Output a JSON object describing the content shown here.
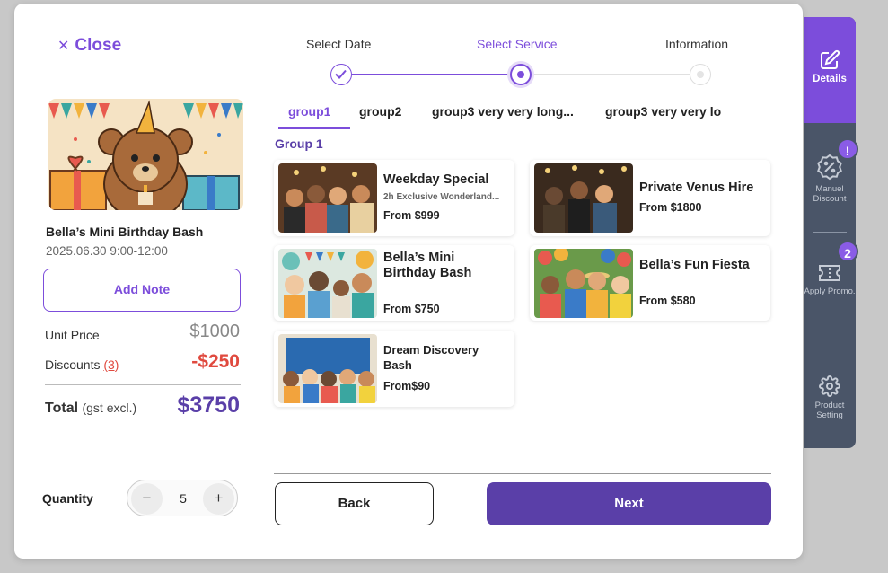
{
  "close": {
    "label": "Close"
  },
  "item": {
    "title": "Bella’s Mini Birthday Bash",
    "date": "2025.06.30 9:00-12:00"
  },
  "add_note": "Add Note",
  "pricing": {
    "unit_label": "Unit Price",
    "unit_value": "$1000",
    "discount_label": "Discounts",
    "discount_count": "(3)",
    "discount_value": "-$250",
    "total_label": "Total",
    "total_sub": "(gst excl.)",
    "total_value": "$3750"
  },
  "quantity": {
    "label": "Quantity",
    "value": "5",
    "minus": "−",
    "plus": "+"
  },
  "steps": [
    {
      "label": "Select Date",
      "state": "done"
    },
    {
      "label": "Select Service",
      "state": "current"
    },
    {
      "label": "Information",
      "state": "pending"
    }
  ],
  "tabs": [
    "group1",
    "group2",
    "group3 very very long...",
    "group3 very very lo"
  ],
  "group_heading": "Group 1",
  "cards": [
    {
      "title": "Weekday Special",
      "desc": "2h Exclusive Wonderland...",
      "price": "From $999"
    },
    {
      "title": "Private Venus Hire",
      "desc": "",
      "price": "From $1800"
    },
    {
      "title": "Bella’s Mini Birthday Bash",
      "desc": "",
      "price": "From $750"
    },
    {
      "title": "Bella’s Fun Fiesta",
      "desc": "",
      "price": "From $580"
    },
    {
      "title": "Dream Discovery Bash",
      "desc": "",
      "price": "From$90"
    }
  ],
  "buttons": {
    "back": "Back",
    "next": "Next"
  },
  "side": {
    "details": "Details",
    "manuel_discount": "Manuel Discount",
    "apply_promo": "Apply Promo.",
    "product_setting": "Product Setting",
    "badge_discount": "!",
    "badge_promo": "2"
  },
  "colors": {
    "accent": "#7c4ddb",
    "accent_dark": "#5a3fa8",
    "negative": "#e04a3f",
    "side_panel": "#4a5568"
  }
}
